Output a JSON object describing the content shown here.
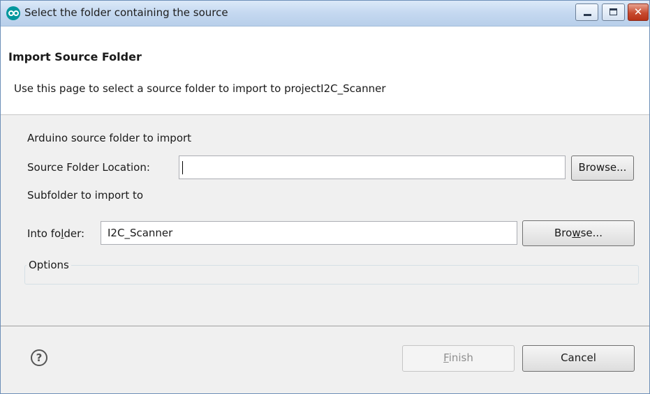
{
  "window": {
    "title": "Select the folder containing the source",
    "app_icon": "arduino-icon",
    "controls": [
      "minimize-icon",
      "maximize-icon",
      "close-icon"
    ]
  },
  "header": {
    "title": "Import Source Folder",
    "description": "Use this page to select a source folder to import to projectI2C_Scanner"
  },
  "source": {
    "section_label": "Arduino source folder to import",
    "location_label": "Source Folder Location:",
    "location_value": "",
    "browse_label": "Browse..."
  },
  "target": {
    "section_label": "Subfolder to import to",
    "into_label_pre": "Into fo",
    "into_label_mnemonic": "l",
    "into_label_post": "der:",
    "into_value": "I2C_Scanner",
    "browse_pre": "Bro",
    "browse_mnemonic": "w",
    "browse_post": "se..."
  },
  "options": {
    "legend": "Options"
  },
  "footer": {
    "help_glyph": "?",
    "finish_mnemonic": "F",
    "finish_rest": "inish",
    "finish_enabled": false,
    "cancel_label": "Cancel"
  }
}
